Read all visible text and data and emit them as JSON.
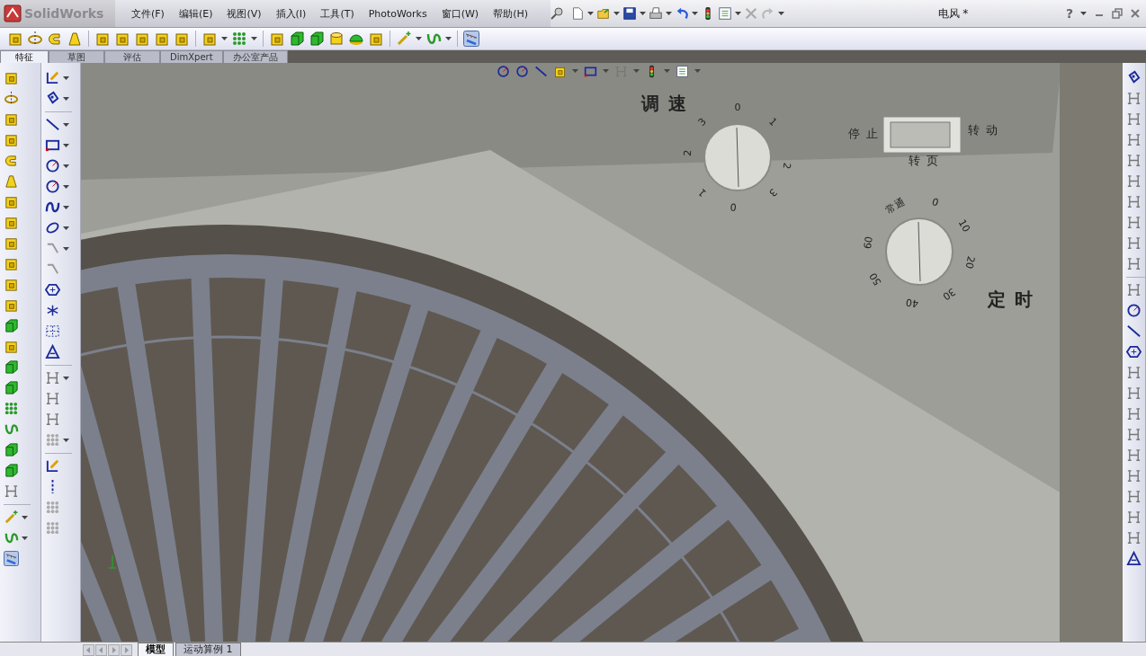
{
  "app": {
    "logo": "SolidWorks",
    "document_title": "电风 *",
    "help": "?"
  },
  "menu": [
    "文件(F)",
    "编辑(E)",
    "视图(V)",
    "插入(I)",
    "工具(T)",
    "PhotoWorks",
    "窗口(W)",
    "帮助(H)"
  ],
  "command_tabs": [
    {
      "label": "特征",
      "selected": true
    },
    {
      "label": "草图",
      "selected": false
    },
    {
      "label": "评估",
      "selected": false
    },
    {
      "label": "DimXpert",
      "selected": false
    },
    {
      "label": "办公室产品",
      "selected": false
    }
  ],
  "model": {
    "speed_label": "调速",
    "speed_marks": [
      "0",
      "1",
      "2",
      "3",
      "0",
      "1",
      "2",
      "3"
    ],
    "switch_left": "停止",
    "switch_right": "转动",
    "switch_bottom": "转页",
    "timer_label": "定时",
    "timer_marks": [
      "常通",
      "0",
      "10",
      "20",
      "30",
      "40",
      "50",
      "60"
    ]
  },
  "bottom_tabs": [
    {
      "label": "模型",
      "selected": true
    },
    {
      "label": "运动算例 1",
      "selected": false
    }
  ]
}
